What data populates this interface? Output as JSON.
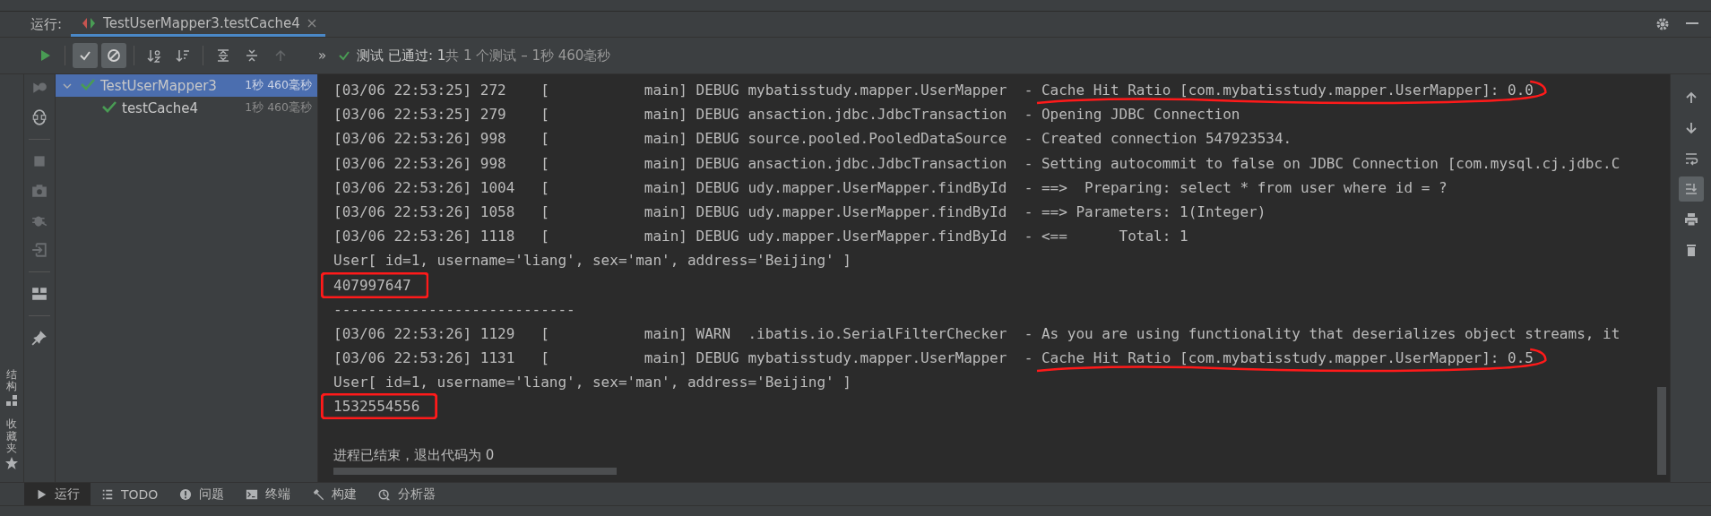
{
  "run_tabs": {
    "label": "运行:",
    "tabs": [
      {
        "title": "TestUserMapper3.testCache4",
        "selected": true
      }
    ]
  },
  "toolbar": {
    "buttons": [
      {
        "kind": "rerun",
        "disabled": false,
        "on": false
      },
      {
        "kind": "show-passed",
        "disabled": false,
        "on": true
      },
      {
        "kind": "show-ignored",
        "disabled": false,
        "on": true
      },
      {
        "kind": "sort-alpha",
        "disabled": false,
        "on": false
      },
      {
        "kind": "sort-duration",
        "disabled": false,
        "on": false
      },
      {
        "kind": "expand-all",
        "disabled": false,
        "on": false
      },
      {
        "kind": "collapse-all",
        "disabled": false,
        "on": false
      },
      {
        "kind": "previous",
        "disabled": true,
        "on": false
      }
    ],
    "more": "»",
    "status": {
      "passed": true,
      "title": "测试 已通过: 1",
      "summary": "共 1 个测试 – 1秒 460毫秒"
    }
  },
  "side_labels": [
    {
      "label": "结构"
    },
    {
      "label": "收藏夹"
    }
  ],
  "tree": [
    {
      "name": "TestUserMapper3",
      "duration": "1秒 460毫秒",
      "passed": true,
      "expanded": true,
      "selected": true,
      "children": [
        {
          "name": "testCache4",
          "duration": "1秒 460毫秒",
          "passed": true,
          "selected": false
        }
      ]
    }
  ],
  "console": {
    "lines": [
      {
        "kind": "log",
        "head": "[03/06 22:53:25] 272    [           main] DEBUG mybatisstudy.mapper.UserMapper  - ",
        "message": "Cache Hit Ratio [com.mybatisstudy.mapper.UserMapper]: 0.0",
        "underlined": true
      },
      {
        "kind": "log",
        "head": "[03/06 22:53:25] 279    [           main] DEBUG ansaction.jdbc.JdbcTransaction  - ",
        "message": "Opening JDBC Connection"
      },
      {
        "kind": "log",
        "head": "[03/06 22:53:26] 998    [           main] DEBUG source.pooled.PooledDataSource  - ",
        "message": "Created connection 547923534."
      },
      {
        "kind": "log",
        "head": "[03/06 22:53:26] 998    [           main] DEBUG ansaction.jdbc.JdbcTransaction  - ",
        "message": "Setting autocommit to false on JDBC Connection [com.mysql.cj.jdbc.C"
      },
      {
        "kind": "log",
        "head": "[03/06 22:53:26] 1004   [           main] DEBUG udy.mapper.UserMapper.findById  - ",
        "message": "==>  Preparing: select * from user where id = ?"
      },
      {
        "kind": "log",
        "head": "[03/06 22:53:26] 1058   [           main] DEBUG udy.mapper.UserMapper.findById  - ",
        "message": "==> Parameters: 1(Integer)"
      },
      {
        "kind": "log",
        "head": "[03/06 22:53:26] 1118   [           main] DEBUG udy.mapper.UserMapper.findById  - ",
        "message": "<==      Total: 1"
      },
      {
        "kind": "plain",
        "text": "User[ id=1, username='liang', sex='man', address='Beijing' ]"
      },
      {
        "kind": "plain",
        "text": "407997647",
        "boxed": true
      },
      {
        "kind": "plain",
        "text": "----------------------------"
      },
      {
        "kind": "log",
        "head": "[03/06 22:53:26] 1129   [           main] WARN  .ibatis.io.SerialFilterChecker  - ",
        "message": "As you are using functionality that deserializes object streams, it"
      },
      {
        "kind": "log",
        "head": "[03/06 22:53:26] 1131   [           main] DEBUG mybatisstudy.mapper.UserMapper  - ",
        "message": "Cache Hit Ratio [com.mybatisstudy.mapper.UserMapper]: 0.5",
        "underlined": true
      },
      {
        "kind": "plain",
        "text": "User[ id=1, username='liang', sex='man', address='Beijing' ]"
      },
      {
        "kind": "plain",
        "text": "1532554556",
        "boxed": true
      },
      {
        "kind": "blank"
      },
      {
        "kind": "plain",
        "text": "进程已结束，退出代码为 0"
      }
    ]
  },
  "console_tools": [
    {
      "kind": "up",
      "on": false
    },
    {
      "kind": "down",
      "on": false
    },
    {
      "kind": "wrap",
      "on": false
    },
    {
      "kind": "scroll-end",
      "on": true
    },
    {
      "kind": "print",
      "on": false
    },
    {
      "kind": "clear",
      "on": false
    }
  ],
  "bottom_tabs": [
    {
      "kind": "run",
      "label": "运行",
      "selected": true
    },
    {
      "kind": "todo",
      "label": "TODO",
      "selected": false
    },
    {
      "kind": "problems",
      "label": "问题",
      "selected": false
    },
    {
      "kind": "terminal",
      "label": "终端",
      "selected": false
    },
    {
      "kind": "build",
      "label": "构建",
      "selected": false
    },
    {
      "kind": "profiler",
      "label": "分析器",
      "selected": false
    }
  ]
}
